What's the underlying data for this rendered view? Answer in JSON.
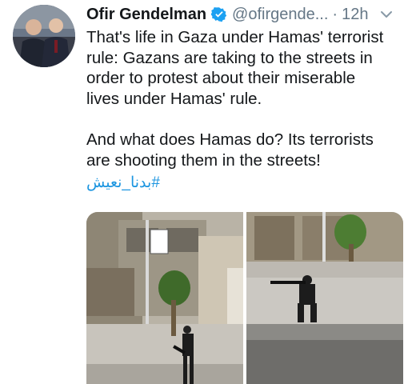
{
  "tweet": {
    "author_name": "Ofir Gendelman",
    "handle": "@ofirgende...",
    "separator": "·",
    "time": "12h",
    "paragraphs": [
      "That's life in Gaza under Hamas' terrorist\nrule: Gazans are taking to the streets in\norder to protest about their miserable\nlives under Hamas' rule.",
      "And what does Hamas do? Its terrorists\nare shooting them in the streets!"
    ],
    "hashtag": "#بدنا_نعيش"
  },
  "icons": {
    "verified": "verified-badge-icon",
    "more": "chevron-down-icon"
  },
  "colors": {
    "text": "#14171a",
    "secondary": "#657786",
    "link": "#1b95e0",
    "verified": "#1da1f2"
  }
}
